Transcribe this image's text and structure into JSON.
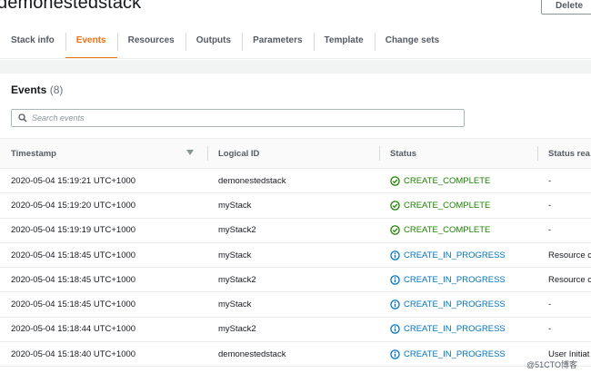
{
  "header": {
    "title": "demonestedstack",
    "delete_label": "Delete"
  },
  "tabs": [
    {
      "label": "Stack info",
      "active": false
    },
    {
      "label": "Events",
      "active": true
    },
    {
      "label": "Resources",
      "active": false
    },
    {
      "label": "Outputs",
      "active": false
    },
    {
      "label": "Parameters",
      "active": false
    },
    {
      "label": "Template",
      "active": false
    },
    {
      "label": "Change sets",
      "active": false
    }
  ],
  "events": {
    "title": "Events",
    "count": "(8)",
    "search_placeholder": "Search events",
    "columns": [
      "Timestamp",
      "Logical ID",
      "Status",
      "Status rea"
    ],
    "rows": [
      {
        "timestamp": "2020-05-04 15:19:21 UTC+1000",
        "logical_id": "demonestedstack",
        "status": "CREATE_COMPLETE",
        "kind": "ok",
        "reason": "-"
      },
      {
        "timestamp": "2020-05-04 15:19:20 UTC+1000",
        "logical_id": "myStack",
        "status": "CREATE_COMPLETE",
        "kind": "ok",
        "reason": "-"
      },
      {
        "timestamp": "2020-05-04 15:19:19 UTC+1000",
        "logical_id": "myStack2",
        "status": "CREATE_COMPLETE",
        "kind": "ok",
        "reason": "-"
      },
      {
        "timestamp": "2020-05-04 15:18:45 UTC+1000",
        "logical_id": "myStack",
        "status": "CREATE_IN_PROGRESS",
        "kind": "progress",
        "reason": "Resource c"
      },
      {
        "timestamp": "2020-05-04 15:18:45 UTC+1000",
        "logical_id": "myStack2",
        "status": "CREATE_IN_PROGRESS",
        "kind": "progress",
        "reason": "Resource c"
      },
      {
        "timestamp": "2020-05-04 15:18:45 UTC+1000",
        "logical_id": "myStack",
        "status": "CREATE_IN_PROGRESS",
        "kind": "progress",
        "reason": "-"
      },
      {
        "timestamp": "2020-05-04 15:18:44 UTC+1000",
        "logical_id": "myStack2",
        "status": "CREATE_IN_PROGRESS",
        "kind": "progress",
        "reason": "-"
      },
      {
        "timestamp": "2020-05-04 15:18:40 UTC+1000",
        "logical_id": "demonestedstack",
        "status": "CREATE_IN_PROGRESS",
        "kind": "progress",
        "reason": "User Initiat"
      }
    ]
  },
  "watermark": "@51CTO博客",
  "colors": {
    "accent": "#ec7211",
    "success": "#1d8102",
    "info": "#0073bb"
  },
  "icons": {
    "complete": "check-circle-icon",
    "progress": "info-circle-icon",
    "search": "search-icon",
    "sort": "sort-down-icon"
  }
}
